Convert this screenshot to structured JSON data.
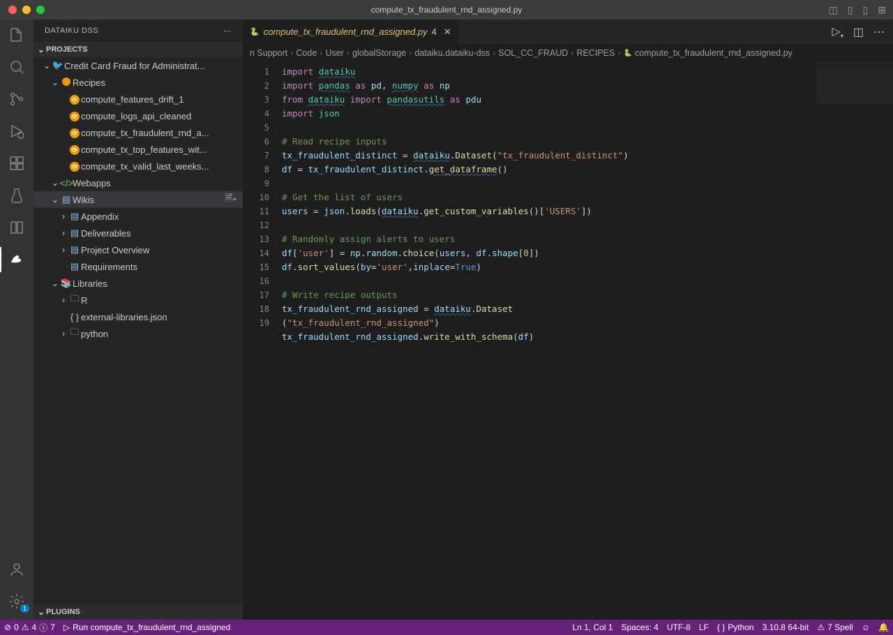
{
  "window": {
    "title": "compute_tx_fraudulent_rnd_assigned.py"
  },
  "sidebar": {
    "title": "DATAIKU DSS",
    "sections": {
      "projects": "PROJECTS",
      "plugins": "PLUGINS"
    },
    "project_name": "Credit Card Fraud for Administrat...",
    "recipes_label": "Recipes",
    "recipes": [
      "compute_features_drift_1",
      "compute_logs_api_cleaned",
      "compute_tx_fraudulent_rnd_a...",
      "compute_tx_top_features_wit...",
      "compute_tx_valid_last_weeks..."
    ],
    "webapps_label": "Webapps",
    "wikis_label": "Wikis",
    "wikis": [
      "Appendix",
      "Deliverables",
      "Project Overview",
      "Requirements"
    ],
    "libraries_label": "Libraries",
    "libraries": [
      "R",
      "external-libraries.json",
      "python"
    ]
  },
  "tab": {
    "filename": "compute_tx_fraudulent_rnd_assigned.py",
    "modified_count": "4"
  },
  "breadcrumbs": [
    "n Support",
    "Code",
    "User",
    "globalStorage",
    "dataiku.dataiku-dss",
    "SOL_CC_FRAUD",
    "RECIPES",
    "compute_tx_fraudulent_rnd_assigned.py"
  ],
  "code_lines": 19,
  "statusbar": {
    "errors": "0",
    "warnings": "4",
    "info": "7",
    "run_label": "Run compute_tx_fraudulent_rnd_assigned",
    "cursor": "Ln 1, Col 1",
    "spaces": "Spaces: 4",
    "encoding": "UTF-8",
    "eol": "LF",
    "lang": "Python",
    "interpreter": "3.10.8 64-bit",
    "spell": "7 Spell"
  },
  "gear_badge": "1"
}
